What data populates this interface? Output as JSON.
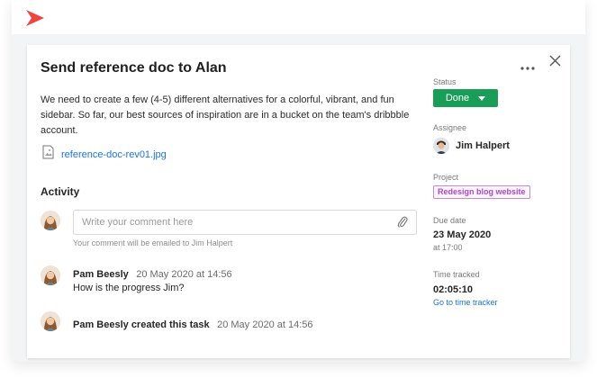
{
  "task": {
    "title": "Send reference doc to Alan",
    "description": "We need to create a few (4-5) different alternatives for a  colorful, vibrant, and fun sidebar. So far, our best sources of inspiration are in a bucket on the team's dribbble account.",
    "attachment": {
      "name": "reference-doc-rev01.jpg",
      "icon": "image-file-icon"
    }
  },
  "activity": {
    "heading": "Activity",
    "comment_placeholder": "Write your comment here",
    "comment_hint": "Your comment will be emailed to Jim Halpert",
    "entries": [
      {
        "author": "Pam Beesly",
        "time": "20 May 2020 at 14:56",
        "text": "How is the progress Jim?"
      },
      {
        "author": "Pam Beesly created this task",
        "time": "20 May 2020 at 14:56"
      }
    ]
  },
  "sidebar": {
    "status_label": "Status",
    "status_value": "Done",
    "assignee_label": "Assignee",
    "assignee_name": "Jim Halpert",
    "project_label": "Project",
    "project_value": "Redesign blog website",
    "due_label": "Due date",
    "due_date": "23 May 2020",
    "due_time": "at 17:00",
    "time_label": "Time tracked",
    "time_value": "02:05:10",
    "time_link": "Go to time tracker"
  },
  "colors": {
    "accent": "#1a73e8",
    "status_done": "#1a9e57",
    "project_tag": "#a84bc9",
    "logo": "#f0453f"
  }
}
